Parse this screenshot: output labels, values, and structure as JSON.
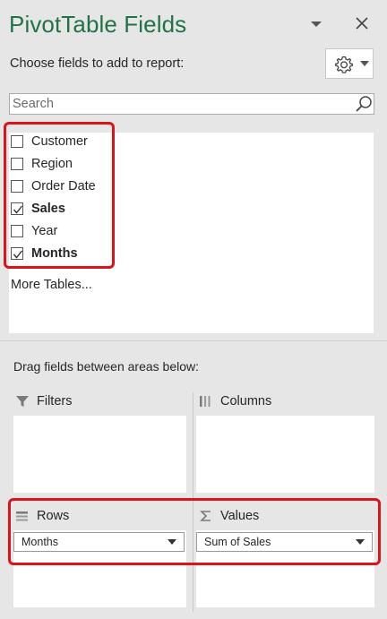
{
  "header": {
    "title": "PivotTable Fields",
    "subtitle": "Choose fields to add to report:"
  },
  "search": {
    "placeholder": "Search"
  },
  "fields": [
    {
      "label": "Customer",
      "checked": false
    },
    {
      "label": "Region",
      "checked": false
    },
    {
      "label": "Order Date",
      "checked": false
    },
    {
      "label": "Sales",
      "checked": true
    },
    {
      "label": "Year",
      "checked": false
    },
    {
      "label": "Months",
      "checked": true
    }
  ],
  "more_tables": "More Tables...",
  "areas": {
    "instruction": "Drag fields between areas below:",
    "filters": {
      "label": "Filters"
    },
    "columns": {
      "label": "Columns"
    },
    "rows": {
      "label": "Rows",
      "item": "Months"
    },
    "values": {
      "label": "Values",
      "item": "Sum of Sales"
    }
  },
  "colors": {
    "title": "#217346",
    "highlight": "#d9141b"
  }
}
